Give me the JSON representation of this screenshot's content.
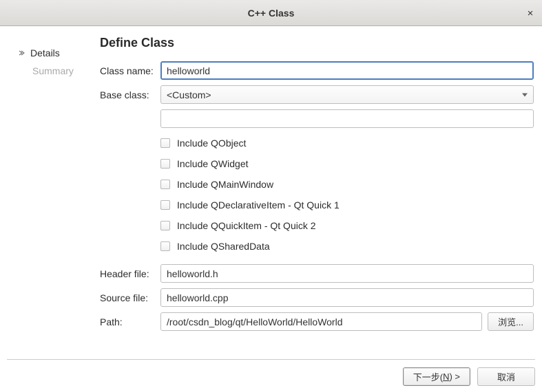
{
  "window": {
    "title": "C++ Class",
    "close_symbol": "×"
  },
  "nav": {
    "details": "Details",
    "summary": "Summary"
  },
  "heading": "Define Class",
  "labels": {
    "class_name": "Class name:",
    "base_class": "Base class:",
    "header_file": "Header file:",
    "source_file": "Source file:",
    "path": "Path:"
  },
  "fields": {
    "class_name": "helloworld",
    "base_class_selected": "<Custom>",
    "base_class_custom": "",
    "header_file": "helloworld.h",
    "source_file": "helloworld.cpp",
    "path": "/root/csdn_blog/qt/HelloWorld/HelloWorld"
  },
  "checks": [
    {
      "label": "Include QObject"
    },
    {
      "label": "Include QWidget"
    },
    {
      "label": "Include QMainWindow"
    },
    {
      "label": "Include QDeclarativeItem - Qt Quick 1"
    },
    {
      "label": "Include QQuickItem - Qt Quick 2"
    },
    {
      "label": "Include QSharedData"
    }
  ],
  "buttons": {
    "browse": "浏览...",
    "next_prefix": "下一步(",
    "next_mnemonic": "N",
    "next_suffix": ") >",
    "cancel": "取消"
  }
}
